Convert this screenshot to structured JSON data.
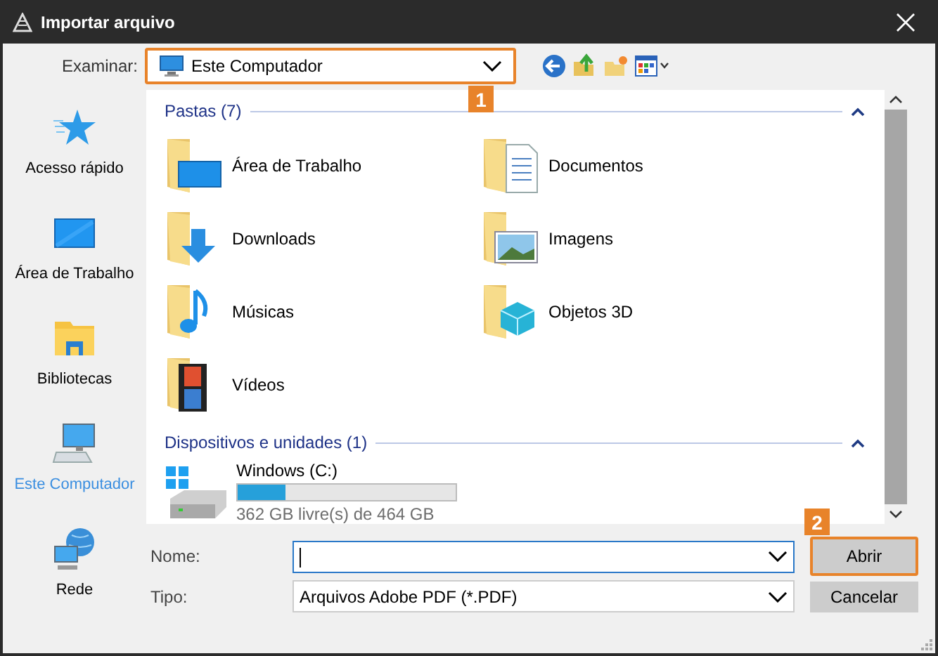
{
  "window": {
    "title": "Importar arquivo"
  },
  "look_in": {
    "label": "Examinar:",
    "value": "Este Computador",
    "callout": "1"
  },
  "sidebar": {
    "items": [
      {
        "label": "Acesso rápido",
        "selected": false
      },
      {
        "label": "Área de Trabalho",
        "selected": false
      },
      {
        "label": "Bibliotecas",
        "selected": false
      },
      {
        "label": "Este Computador",
        "selected": true
      },
      {
        "label": "Rede",
        "selected": false
      }
    ]
  },
  "folders_group": {
    "title": "Pastas (7)",
    "expanded": true,
    "items": [
      {
        "label": "Área de Trabalho"
      },
      {
        "label": "Documentos"
      },
      {
        "label": "Downloads"
      },
      {
        "label": "Imagens"
      },
      {
        "label": "Músicas"
      },
      {
        "label": "Objetos 3D"
      },
      {
        "label": "Vídeos"
      }
    ]
  },
  "devices_group": {
    "title": "Dispositivos e unidades (1)",
    "expanded": true,
    "items": [
      {
        "name": "Windows (C:)",
        "level": 0.22,
        "free": "362 GB livre(s) de 464 GB"
      }
    ]
  },
  "name_field": {
    "label": "Nome:",
    "focused": true
  },
  "type_field": {
    "label": "Tipo:",
    "value": "Arquivos Adobe PDF (*.PDF)"
  },
  "buttons": [
    {
      "label": "Abrir",
      "callout": "2"
    },
    {
      "label": "Cancelar"
    }
  ]
}
